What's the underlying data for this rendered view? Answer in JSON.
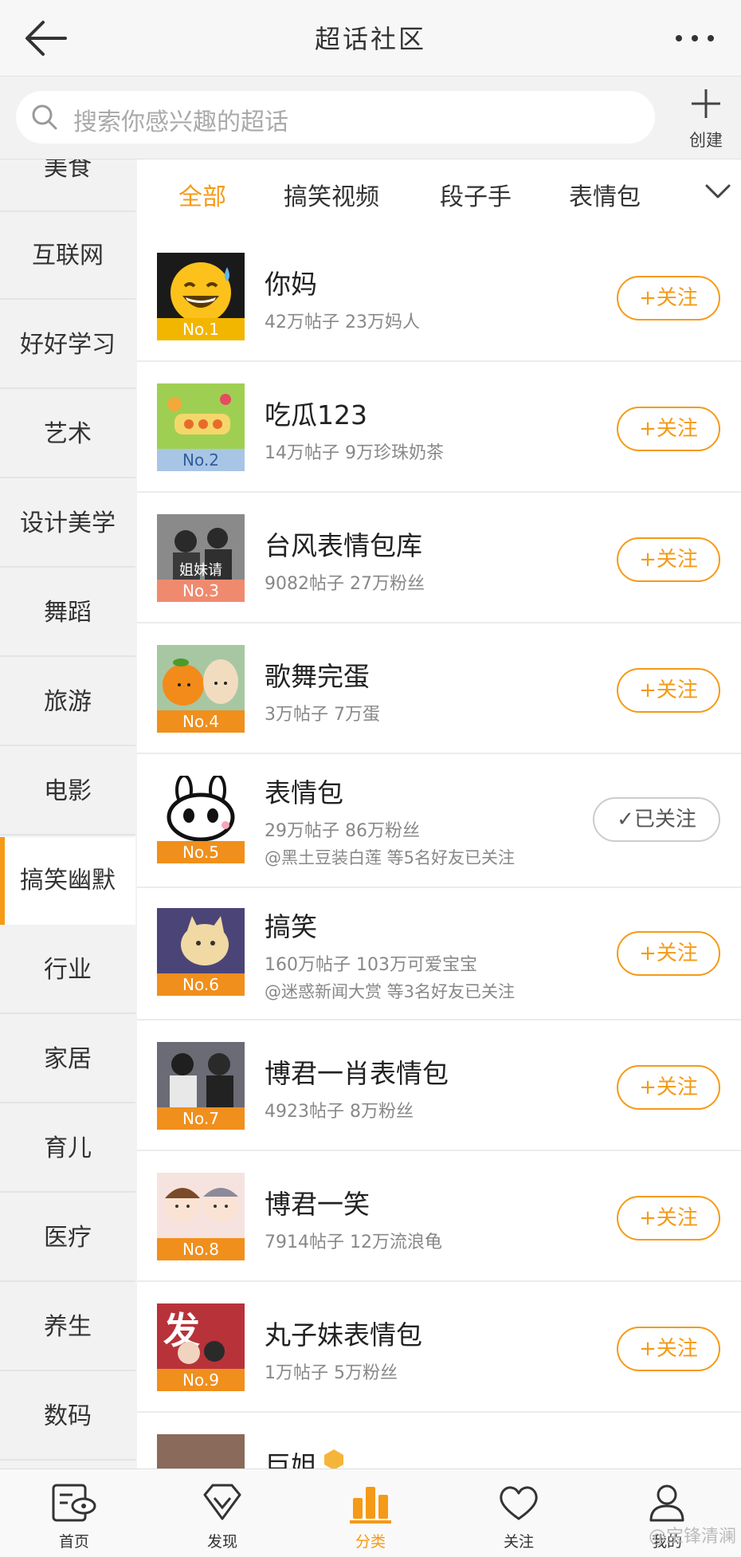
{
  "header": {
    "title": "超话社区"
  },
  "search": {
    "placeholder": "搜索你感兴趣的超话",
    "create_label": "创建"
  },
  "sidebar": {
    "items": [
      {
        "label": "美食"
      },
      {
        "label": "互联网"
      },
      {
        "label": "好好学习"
      },
      {
        "label": "艺术"
      },
      {
        "label": "设计美学"
      },
      {
        "label": "舞蹈"
      },
      {
        "label": "旅游"
      },
      {
        "label": "电影"
      },
      {
        "label": "搞笑幽默",
        "active": true
      },
      {
        "label": "行业"
      },
      {
        "label": "家居"
      },
      {
        "label": "育儿"
      },
      {
        "label": "医疗"
      },
      {
        "label": "养生"
      },
      {
        "label": "数码"
      }
    ]
  },
  "tabs": [
    {
      "label": "全部",
      "active": true
    },
    {
      "label": "搞笑视频"
    },
    {
      "label": "段子手"
    },
    {
      "label": "表情包"
    }
  ],
  "topics": [
    {
      "name": "你妈",
      "rank": "No.1",
      "stats": "42万帖子 23万妈人",
      "friends": "",
      "button": "+关注",
      "followed": false
    },
    {
      "name": "吃瓜123",
      "rank": "No.2",
      "stats": "14万帖子 9万珍珠奶茶",
      "friends": "",
      "button": "+关注",
      "followed": false
    },
    {
      "name": "台风表情包库",
      "rank": "No.3",
      "stats": "9082帖子 27万粉丝",
      "friends": "",
      "button": "+关注",
      "followed": false,
      "avatar_text": "姐妹请"
    },
    {
      "name": "歌舞完蛋",
      "rank": "No.4",
      "stats": "3万帖子 7万蛋",
      "friends": "",
      "button": "+关注",
      "followed": false
    },
    {
      "name": "表情包",
      "rank": "No.5",
      "stats": "29万帖子 86万粉丝",
      "friends": "@黑土豆装白莲 等5名好友已关注",
      "button": "已关注",
      "followed": true
    },
    {
      "name": "搞笑",
      "rank": "No.6",
      "stats": "160万帖子 103万可爱宝宝",
      "friends": "@迷惑新闻大赏 等3名好友已关注",
      "button": "+关注",
      "followed": false
    },
    {
      "name": "博君一肖表情包",
      "rank": "No.7",
      "stats": "4923帖子 8万粉丝",
      "friends": "",
      "button": "+关注",
      "followed": false
    },
    {
      "name": "博君一笑",
      "rank": "No.8",
      "stats": "7914帖子 12万流浪龟",
      "friends": "",
      "button": "+关注",
      "followed": false
    },
    {
      "name": "丸子妹表情包",
      "rank": "No.9",
      "stats": "1万帖子 5万粉丝",
      "friends": "",
      "button": "+关注",
      "followed": false,
      "avatar_text": "发"
    },
    {
      "name": "巨姐",
      "rank": "",
      "stats": "",
      "friends": "",
      "button": "",
      "followed": false
    }
  ],
  "bottom_nav": [
    {
      "label": "首页",
      "icon": "home-eye-icon"
    },
    {
      "label": "发现",
      "icon": "diamond-icon"
    },
    {
      "label": "分类",
      "icon": "bar-chart-icon",
      "active": true
    },
    {
      "label": "关注",
      "icon": "heart-icon"
    },
    {
      "label": "我的",
      "icon": "profile-icon"
    }
  ],
  "watermark": "@宝锋清澜",
  "colors": {
    "accent": "#f59a16",
    "text": "#333333",
    "muted": "#888888"
  }
}
